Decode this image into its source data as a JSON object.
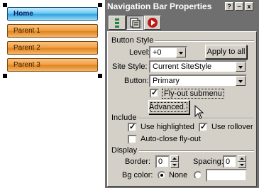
{
  "preview": {
    "buttons": [
      "Home",
      "Parent 1",
      "Parent 2",
      "Parent 3"
    ]
  },
  "panel": {
    "title": "Navigation Bar Properties",
    "titlebar_buttons": [
      "?",
      "–",
      "x"
    ],
    "tools": [
      "list-icon",
      "pages-icon",
      "record-icon"
    ],
    "button_style": {
      "heading": "Button Style",
      "level_label": "Level:",
      "level_value": "+0",
      "apply_all": "Apply to all",
      "site_style_label": "Site Style:",
      "site_style_value": "Current SiteStyle",
      "button_label": "Button:",
      "button_value": "Primary",
      "flyout_label": "Fly-out submenu",
      "flyout_checked": true,
      "advanced": "Advanced..."
    },
    "include": {
      "heading": "Include",
      "use_highlighted": "Use highlighted",
      "use_highlighted_checked": true,
      "use_rollover": "Use rollover",
      "use_rollover_checked": true,
      "auto_close": "Auto-close fly-out",
      "auto_close_checked": false
    },
    "display": {
      "heading": "Display",
      "border_label": "Border:",
      "border_value": "0",
      "spacing_label": "Spacing:",
      "spacing_value": "0",
      "bgcolor_label": "Bg color:",
      "none_label": "None",
      "none_selected": true
    }
  }
}
